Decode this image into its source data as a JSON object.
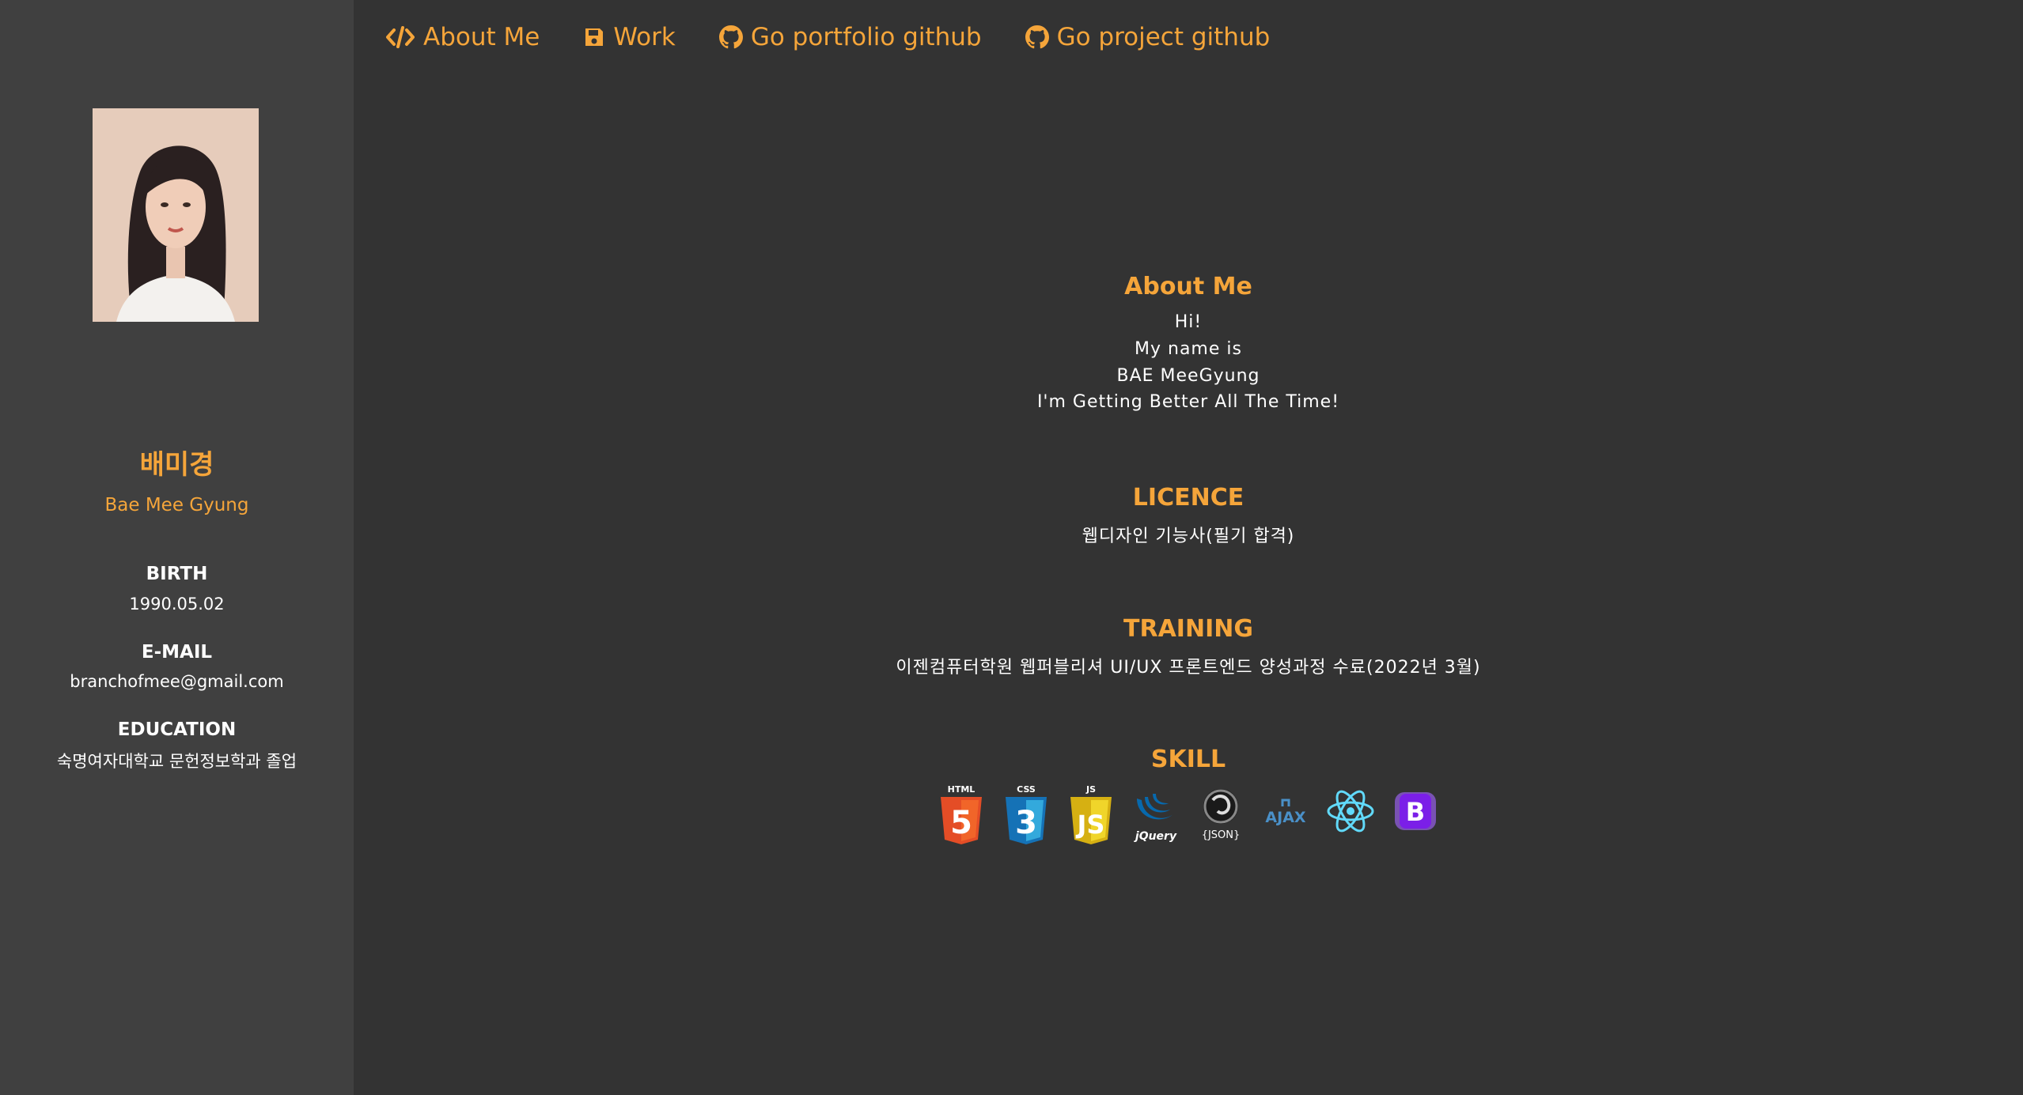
{
  "nav": {
    "items": [
      {
        "label": "About Me",
        "icon": "code-icon"
      },
      {
        "label": "Work",
        "icon": "save-icon"
      },
      {
        "label": "Go portfolio github",
        "icon": "github-icon"
      },
      {
        "label": "Go project github",
        "icon": "github-icon"
      }
    ]
  },
  "profile": {
    "name_ko": "배미경",
    "name_en": "Bae Mee Gyung",
    "birth_label": "BIRTH",
    "birth": "1990.05.02",
    "email_label": "E-MAIL",
    "email": "branchofmee@gmail.com",
    "education_label": "EDUCATION",
    "education": "숙명여자대학교 문헌정보학과 졸업"
  },
  "about": {
    "title": "About Me",
    "lines": [
      "Hi!",
      "My name is",
      "BAE MeeGyung",
      "I'm Getting Better All The Time!"
    ]
  },
  "licence": {
    "title": "LICENCE",
    "text": "웹디자인 기능사(필기 합격)"
  },
  "training": {
    "title": "TRAINING",
    "text": "이젠컴퓨터학원 웹퍼블리셔 UI/UX 프론트엔드 양성과정 수료(2022년 3월)"
  },
  "skill": {
    "title": "SKILL",
    "items": [
      {
        "name": "html5-icon",
        "label": "HTML"
      },
      {
        "name": "css3-icon",
        "label": "CSS"
      },
      {
        "name": "js-icon",
        "label": "JS"
      },
      {
        "name": "jquery-icon",
        "label": "jQuery"
      },
      {
        "name": "json-icon",
        "label": "{JSON}"
      },
      {
        "name": "ajax-icon",
        "label": "AJAX"
      },
      {
        "name": "react-icon",
        "label": ""
      },
      {
        "name": "bootstrap-icon",
        "label": "B"
      }
    ]
  },
  "colors": {
    "accent": "#f5a53a",
    "sidebar_bg": "#404040",
    "main_bg": "#333333"
  }
}
